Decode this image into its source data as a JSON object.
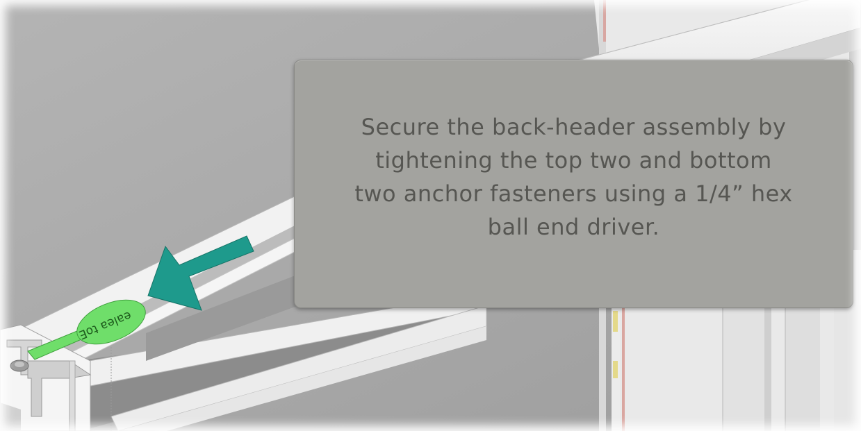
{
  "callout": {
    "lines": [
      "Secure the back-header assembly by",
      "tightening the top two and bottom",
      "two anchor fasteners using a 1/4” hex",
      "ball end driver."
    ]
  },
  "tag": {
    "label": "ealea toE"
  },
  "colors": {
    "arrow": "#1e9a8c",
    "tag": "#6fde6a",
    "callout_bg": "#a3a39f",
    "callout_text": "#565652",
    "wall": "#a9a9a9"
  },
  "icons": {
    "arrow": "teal-arrow-icon",
    "tag": "green-tag-icon"
  }
}
